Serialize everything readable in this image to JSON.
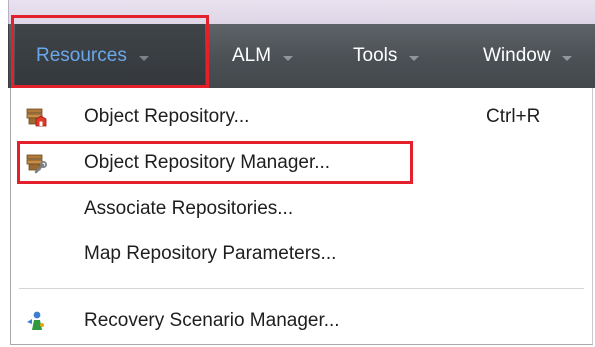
{
  "menubar": {
    "items": [
      {
        "label": "Resources",
        "state": "open"
      },
      {
        "label": "ALM"
      },
      {
        "label": "Tools"
      },
      {
        "label": "Window"
      }
    ]
  },
  "resources_menu": {
    "items": [
      {
        "label": "Object Repository...",
        "shortcut": "Ctrl+R",
        "icon": "object-repository-icon"
      },
      {
        "label": "Object Repository Manager...",
        "icon": "object-repository-manager-icon"
      },
      {
        "label": "Associate Repositories..."
      },
      {
        "label": "Map Repository Parameters..."
      },
      {
        "label": "Recovery Scenario Manager...",
        "icon": "recovery-scenario-manager-icon"
      }
    ]
  },
  "colors": {
    "menubar_bg": "#4b5055",
    "active_menu_text": "#6aa8ec",
    "highlight": "#e3202b"
  }
}
